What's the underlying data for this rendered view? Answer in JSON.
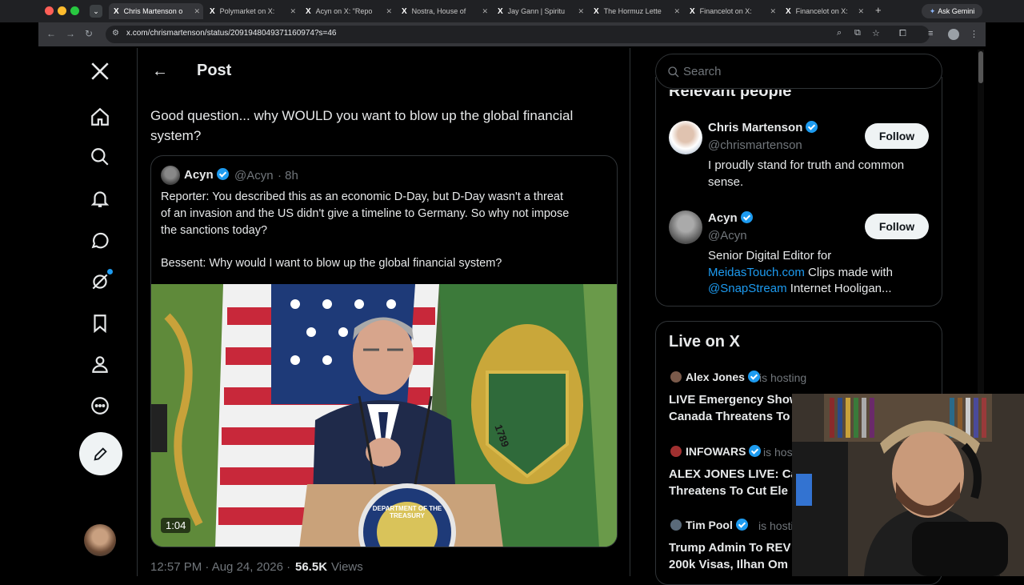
{
  "browser": {
    "tabs": [
      {
        "label": "Chris Martenson o"
      },
      {
        "label": "Polymarket on X:"
      },
      {
        "label": "Acyn on X: \"Repo"
      },
      {
        "label": "Nostra, House of"
      },
      {
        "label": "Jay Gann | Spiritu"
      },
      {
        "label": "The Hormuz Lette"
      },
      {
        "label": "Financelot on X:"
      },
      {
        "label": "Financelot on X:"
      }
    ],
    "new_tab": "+",
    "ask_gemini": "Ask Gemini",
    "url": "x.com/chrismartenson/status/2091948049371160974?s=46"
  },
  "header": {
    "title": "Post"
  },
  "post": {
    "text_line1": "Good question... why WOULD you want to blow up the global financial",
    "text_line2": "system?",
    "quote": {
      "name": "Acyn",
      "handle": "@Acyn",
      "time": "· 8h",
      "line1": "Reporter: You described this as an economic D-Day, but D-Day wasn't a threat",
      "line2": "of an invasion and the US didn't give a timeline to Germany. So why not impose",
      "line3": "the sanctions today?",
      "line4": "Bessent: Why would I want to blow up the global financial system?",
      "video_duration": "1:04",
      "seal_text": "DEPARTMENT OF THE TREASURY",
      "flag_year": "1789"
    },
    "meta_time": "12:57 PM · Aug 24, 2026 ·",
    "views_count": "56.5K",
    "views_label": "Views"
  },
  "search": {
    "placeholder": "Search"
  },
  "relevant": {
    "title": "Relevant people",
    "people": [
      {
        "name": "Chris Martenson",
        "handle": "@chrismartenson",
        "bio1": "I proudly stand for truth and common",
        "bio2": "sense.",
        "follow": "Follow"
      },
      {
        "name": "Acyn",
        "handle": "@Acyn",
        "bio1": "Senior Digital Editor for",
        "bio2_link": "MeidasTouch.com",
        "bio2_rest": " Clips made with",
        "bio3_link": "@SnapStream",
        "bio3_rest": " Internet Hooligan...",
        "follow": "Follow"
      }
    ]
  },
  "live": {
    "title": "Live on X",
    "items": [
      {
        "host": "Alex Jones",
        "status": "is hosting",
        "line1": "LIVE Emergency Show",
        "line2": "Canada Threatens To"
      },
      {
        "host": "INFOWARS",
        "status": "is hosting",
        "line1": "ALEX JONES LIVE: Ca",
        "line2": "Threatens To Cut Ele"
      },
      {
        "host": "Tim Pool",
        "status": "is hosting",
        "line1": "Trump Admin To REV",
        "line2": "200k Visas, Ilhan Om"
      }
    ]
  },
  "colors": {
    "accent": "#1d9bf0",
    "bg": "#000000",
    "border": "#2f3336"
  }
}
